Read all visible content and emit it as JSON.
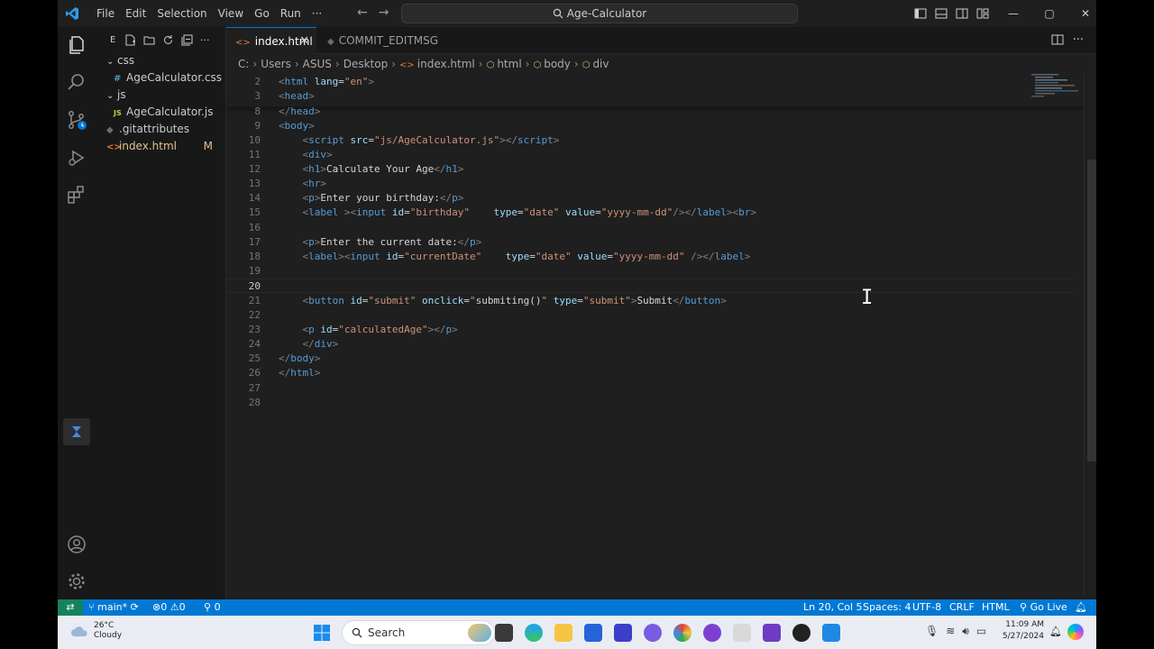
{
  "titlebar": {
    "menu": [
      "File",
      "Edit",
      "Selection",
      "View",
      "Go",
      "Run",
      "···"
    ],
    "search_text": "Age-Calculator"
  },
  "sidebar": {
    "header_label": "E",
    "items": [
      {
        "label": "css",
        "kind": "folder"
      },
      {
        "label": "AgeCalculator.css",
        "kind": "css-file",
        "icon": "#"
      },
      {
        "label": "js",
        "kind": "folder"
      },
      {
        "label": "AgeCalculator.js",
        "kind": "js-file",
        "icon": "JS"
      },
      {
        "label": ".gitattributes",
        "kind": "git-file"
      },
      {
        "label": "index.html",
        "kind": "html-file",
        "badge": "M"
      }
    ]
  },
  "tabs": [
    {
      "label": "index.html",
      "active": true
    },
    {
      "label": "COMMIT_EDITMSG",
      "active": false
    }
  ],
  "breadcrumb": [
    "C:",
    "Users",
    "ASUS",
    "Desktop",
    "index.html",
    "html",
    "body",
    "div"
  ],
  "code": {
    "lines": [
      {
        "n": "2",
        "parts": [
          [
            "br",
            "<"
          ],
          [
            "tag",
            "html"
          ],
          [
            "t",
            " "
          ],
          [
            "attr",
            "lang"
          ],
          [
            "t",
            "="
          ],
          [
            "str",
            "\"en\""
          ],
          [
            "br",
            ">"
          ]
        ]
      },
      {
        "n": "3",
        "parts": [
          [
            "br",
            "<"
          ],
          [
            "tag",
            "head"
          ],
          [
            "br",
            ">"
          ]
        ]
      },
      {
        "n": "8",
        "parts": [
          [
            "br",
            "</"
          ],
          [
            "tag",
            "head"
          ],
          [
            "br",
            ">"
          ]
        ]
      },
      {
        "n": "9",
        "parts": [
          [
            "br",
            "<"
          ],
          [
            "tag",
            "body"
          ],
          [
            "br",
            ">"
          ]
        ]
      },
      {
        "n": "10",
        "parts": [
          [
            "t",
            "    "
          ],
          [
            "br",
            "<"
          ],
          [
            "tag",
            "script"
          ],
          [
            "t",
            " "
          ],
          [
            "attr",
            "src"
          ],
          [
            "t",
            "="
          ],
          [
            "str",
            "\"js/AgeCalculator.js\""
          ],
          [
            "br",
            "></"
          ],
          [
            "tag",
            "script"
          ],
          [
            "br",
            ">"
          ]
        ]
      },
      {
        "n": "11",
        "parts": [
          [
            "t",
            "    "
          ],
          [
            "br",
            "<"
          ],
          [
            "tag",
            "div"
          ],
          [
            "br",
            ">"
          ]
        ]
      },
      {
        "n": "12",
        "parts": [
          [
            "t",
            "    "
          ],
          [
            "br",
            "<"
          ],
          [
            "tag",
            "h1"
          ],
          [
            "br",
            ">"
          ],
          [
            "t",
            "Calculate Your Age"
          ],
          [
            "br",
            "</"
          ],
          [
            "tag",
            "h1"
          ],
          [
            "br",
            ">"
          ]
        ]
      },
      {
        "n": "13",
        "parts": [
          [
            "t",
            "    "
          ],
          [
            "br",
            "<"
          ],
          [
            "tag",
            "hr"
          ],
          [
            "br",
            ">"
          ]
        ]
      },
      {
        "n": "14",
        "parts": [
          [
            "t",
            "    "
          ],
          [
            "br",
            "<"
          ],
          [
            "tag",
            "p"
          ],
          [
            "br",
            ">"
          ],
          [
            "t",
            "Enter your birthday:"
          ],
          [
            "br",
            "</"
          ],
          [
            "tag",
            "p"
          ],
          [
            "br",
            ">"
          ]
        ]
      },
      {
        "n": "15",
        "parts": [
          [
            "t",
            "    "
          ],
          [
            "br",
            "<"
          ],
          [
            "tag",
            "label"
          ],
          [
            "t",
            " "
          ],
          [
            "br",
            "><"
          ],
          [
            "tag",
            "input"
          ],
          [
            "t",
            " "
          ],
          [
            "attr",
            "id"
          ],
          [
            "t",
            "="
          ],
          [
            "str",
            "\"birthday\""
          ],
          [
            "t",
            "    "
          ],
          [
            "attr",
            "type"
          ],
          [
            "t",
            "="
          ],
          [
            "str",
            "\"date\""
          ],
          [
            "t",
            " "
          ],
          [
            "attr",
            "value"
          ],
          [
            "t",
            "="
          ],
          [
            "str",
            "\"yyyy-mm-dd\""
          ],
          [
            "br",
            "/></"
          ],
          [
            "tag",
            "label"
          ],
          [
            "br",
            "><"
          ],
          [
            "tag",
            "br"
          ],
          [
            "br",
            ">"
          ]
        ]
      },
      {
        "n": "16",
        "parts": []
      },
      {
        "n": "17",
        "parts": [
          [
            "t",
            "    "
          ],
          [
            "br",
            "<"
          ],
          [
            "tag",
            "p"
          ],
          [
            "br",
            ">"
          ],
          [
            "t",
            "Enter the current date:"
          ],
          [
            "br",
            "</"
          ],
          [
            "tag",
            "p"
          ],
          [
            "br",
            ">"
          ]
        ]
      },
      {
        "n": "18",
        "parts": [
          [
            "t",
            "    "
          ],
          [
            "br",
            "<"
          ],
          [
            "tag",
            "label"
          ],
          [
            "br",
            "><"
          ],
          [
            "tag",
            "input"
          ],
          [
            "t",
            " "
          ],
          [
            "attr",
            "id"
          ],
          [
            "t",
            "="
          ],
          [
            "str",
            "\"currentDate\""
          ],
          [
            "t",
            "    "
          ],
          [
            "attr",
            "type"
          ],
          [
            "t",
            "="
          ],
          [
            "str",
            "\"date\""
          ],
          [
            "t",
            " "
          ],
          [
            "attr",
            "value"
          ],
          [
            "t",
            "="
          ],
          [
            "str",
            "\"yyyy-mm-dd\""
          ],
          [
            "t",
            " "
          ],
          [
            "br",
            "/></"
          ],
          [
            "tag",
            "label"
          ],
          [
            "br",
            ">"
          ]
        ]
      },
      {
        "n": "19",
        "parts": []
      },
      {
        "n": "20",
        "parts": [],
        "current": true
      },
      {
        "n": "21",
        "parts": [
          [
            "t",
            "    "
          ],
          [
            "br",
            "<"
          ],
          [
            "tag",
            "button"
          ],
          [
            "t",
            " "
          ],
          [
            "attr",
            "id"
          ],
          [
            "t",
            "="
          ],
          [
            "str",
            "\"submit\""
          ],
          [
            "t",
            " "
          ],
          [
            "attr",
            "onclick"
          ],
          [
            "t",
            "="
          ],
          [
            "str",
            "\""
          ],
          [
            "t",
            "submiting()"
          ],
          [
            "str",
            "\""
          ],
          [
            "t",
            " "
          ],
          [
            "attr",
            "type"
          ],
          [
            "t",
            "="
          ],
          [
            "str",
            "\"submit\""
          ],
          [
            "br",
            ">"
          ],
          [
            "t",
            "Submit"
          ],
          [
            "br",
            "</"
          ],
          [
            "tag",
            "button"
          ],
          [
            "br",
            ">"
          ]
        ]
      },
      {
        "n": "22",
        "parts": []
      },
      {
        "n": "23",
        "parts": [
          [
            "t",
            "    "
          ],
          [
            "br",
            "<"
          ],
          [
            "tag",
            "p"
          ],
          [
            "t",
            " "
          ],
          [
            "attr",
            "id"
          ],
          [
            "t",
            "="
          ],
          [
            "str",
            "\"calculatedAge\""
          ],
          [
            "br",
            "></"
          ],
          [
            "tag",
            "p"
          ],
          [
            "br",
            ">"
          ]
        ]
      },
      {
        "n": "24",
        "parts": [
          [
            "t",
            "    "
          ],
          [
            "br",
            "</"
          ],
          [
            "tag",
            "div"
          ],
          [
            "br",
            ">"
          ]
        ]
      },
      {
        "n": "25",
        "parts": [
          [
            "br",
            "</"
          ],
          [
            "tag",
            "body"
          ],
          [
            "br",
            ">"
          ]
        ]
      },
      {
        "n": "26",
        "parts": [
          [
            "br",
            "</"
          ],
          [
            "tag",
            "html"
          ],
          [
            "br",
            ">"
          ]
        ]
      },
      {
        "n": "27",
        "parts": []
      },
      {
        "n": "28",
        "parts": []
      }
    ]
  },
  "statusbar": {
    "branch": "main*",
    "errors": "0",
    "warnings": "0",
    "ports": "0",
    "position": "Ln 20, Col 5",
    "spaces": "Spaces: 4",
    "encoding": "UTF-8",
    "eol": "CRLF",
    "language": "HTML",
    "golive": "Go Live"
  },
  "taskbar": {
    "temperature": "26°C",
    "weather": "Cloudy",
    "search": "Search",
    "time": "11:09 AM",
    "date": "5/27/2024"
  },
  "colors": {
    "accent": "#0078d4",
    "remote": "#16825d",
    "tag": "#569cd6",
    "attr": "#9cdcfe",
    "string": "#ce9178",
    "modified": "#e2c08d"
  }
}
